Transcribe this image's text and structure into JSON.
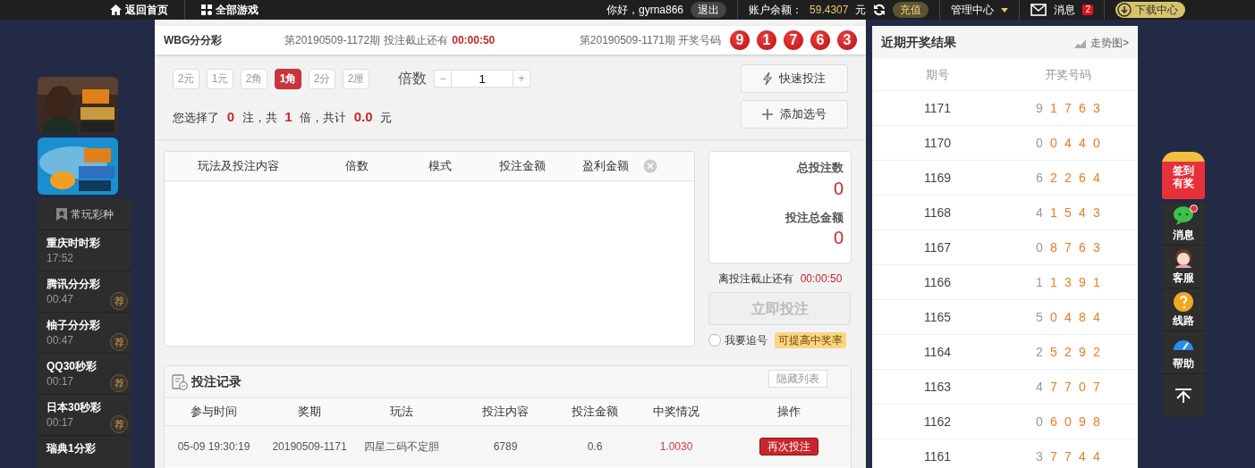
{
  "top_bar": {
    "home": "返回首页",
    "all_games": "全部游戏",
    "greeting": "你好，gyrna866",
    "logout": "退出",
    "balance_label": "账户余额：",
    "balance": "59.4307",
    "currency": "元",
    "recharge": "充值",
    "manage": "管理中心",
    "messages": "消息",
    "message_count": "2",
    "download": "下载中心"
  },
  "sidebar": {
    "favorites": {
      "title": "常玩彩种",
      "items": [
        {
          "name": "重庆时时彩",
          "time": "17:52",
          "recommended": false
        },
        {
          "name": "腾讯分分彩",
          "time": "00:47",
          "recommended": true,
          "tag": "荐"
        },
        {
          "name": "柚子分分彩",
          "time": "00:47",
          "recommended": true,
          "tag": "荐"
        },
        {
          "name": "QQ30秒彩",
          "time": "00:17",
          "recommended": true,
          "tag": "荐"
        },
        {
          "name": "日本30秒彩",
          "time": "00:17",
          "recommended": true,
          "tag": "荐"
        },
        {
          "name": "瑞典1分彩"
        }
      ]
    }
  },
  "game_header": {
    "name": "WBG分分彩",
    "current_issue": "第20190509-1172期",
    "deadline_label": "投注截止还有",
    "countdown": "00:00:50",
    "last_issue": "第20190509-1171期",
    "draw_label": "开奖号码",
    "draw_numbers": [
      "9",
      "1",
      "7",
      "6",
      "3"
    ]
  },
  "units": [
    {
      "label": "2元",
      "selected": false
    },
    {
      "label": "1元",
      "selected": false
    },
    {
      "label": "2角",
      "selected": false
    },
    {
      "label": "1角",
      "selected": true
    },
    {
      "label": "2分",
      "selected": false
    },
    {
      "label": "2厘",
      "selected": false
    }
  ],
  "multiplier": {
    "label": "倍数",
    "minus": "−",
    "value": "1",
    "plus": "+"
  },
  "quick_bet": "快速投注",
  "add_selection": "添加选号",
  "summary": "您选择了 **0** 注，共 **1** 倍，共计 **0.0** 元",
  "cart": {
    "columns": [
      "玩法及投注内容",
      "倍数",
      "模式",
      "投注金额",
      "盈利金额"
    ]
  },
  "totals": {
    "count_label": "总投注数",
    "count": "0",
    "amount_label": "投注总金额",
    "amount": "0",
    "deadline_label": "离投注截止还有",
    "countdown": "00:00:50",
    "submit": "立即投注",
    "submit_disabled": true,
    "chase_label": "我要追号",
    "chase_checked": false,
    "chase_tag": "可提高中奖率"
  },
  "records": {
    "title": "投注记录",
    "hide": "隐藏列表",
    "columns": [
      "参与时间",
      "奖期",
      "玩法",
      "投注内容",
      "投注金额",
      "中奖情况",
      "操作"
    ],
    "rows": [
      {
        "time": "05-09 19:30:19",
        "issue": "20190509-1171",
        "play": "四星二码不定胆",
        "content": "6789",
        "amount": "0.6",
        "win": "1.0030",
        "action": "再次投注"
      }
    ]
  },
  "results": {
    "title": "近期开奖结果",
    "trend": "走势图>",
    "columns": [
      "期号",
      "开奖号码"
    ],
    "rows": [
      {
        "issue": "1171",
        "numbers": [
          "9",
          "1",
          "7",
          "6",
          "3"
        ]
      },
      {
        "issue": "1170",
        "numbers": [
          "0",
          "0",
          "4",
          "4",
          "0"
        ]
      },
      {
        "issue": "1169",
        "numbers": [
          "6",
          "2",
          "2",
          "6",
          "4"
        ]
      },
      {
        "issue": "1168",
        "numbers": [
          "4",
          "1",
          "5",
          "4",
          "3"
        ]
      },
      {
        "issue": "1167",
        "numbers": [
          "0",
          "8",
          "7",
          "6",
          "3"
        ]
      },
      {
        "issue": "1166",
        "numbers": [
          "1",
          "1",
          "3",
          "9",
          "1"
        ]
      },
      {
        "issue": "1165",
        "numbers": [
          "5",
          "0",
          "4",
          "8",
          "4"
        ]
      },
      {
        "issue": "1164",
        "numbers": [
          "2",
          "5",
          "2",
          "9",
          "2"
        ]
      },
      {
        "issue": "1163",
        "numbers": [
          "4",
          "7",
          "7",
          "0",
          "7"
        ]
      },
      {
        "issue": "1162",
        "numbers": [
          "0",
          "6",
          "0",
          "9",
          "8"
        ]
      },
      {
        "issue": "1161",
        "numbers": [
          "3",
          "7",
          "7",
          "4",
          "4"
        ]
      }
    ]
  },
  "float_bar": {
    "sign_in": [
      "签到",
      "有奖"
    ],
    "items": [
      {
        "kind": "chat",
        "label": "消息",
        "badge": true
      },
      {
        "kind": "service",
        "label": "客服",
        "badge": false
      },
      {
        "kind": "route",
        "label": "线路",
        "badge": false
      },
      {
        "kind": "help",
        "label": "帮助",
        "badge": false
      }
    ]
  }
}
